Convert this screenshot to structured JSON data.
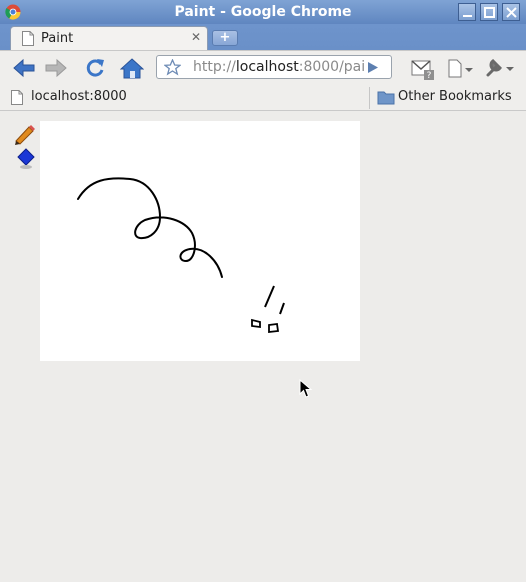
{
  "window": {
    "title": "Paint - Google Chrome"
  },
  "tab": {
    "label": "Paint"
  },
  "address_bar": {
    "prefix": "http://",
    "host": "localhost",
    "path": ":8000/pai"
  },
  "bookmarks": {
    "item": "localhost:8000",
    "other": "Other Bookmarks"
  },
  "tools": [
    {
      "name": "pencil-icon"
    },
    {
      "name": "eraser-icon"
    }
  ],
  "colors": {
    "titlebar": "#6a90c8",
    "canvas": "#ffffff",
    "stroke": "#000000",
    "page": "#edecea"
  }
}
